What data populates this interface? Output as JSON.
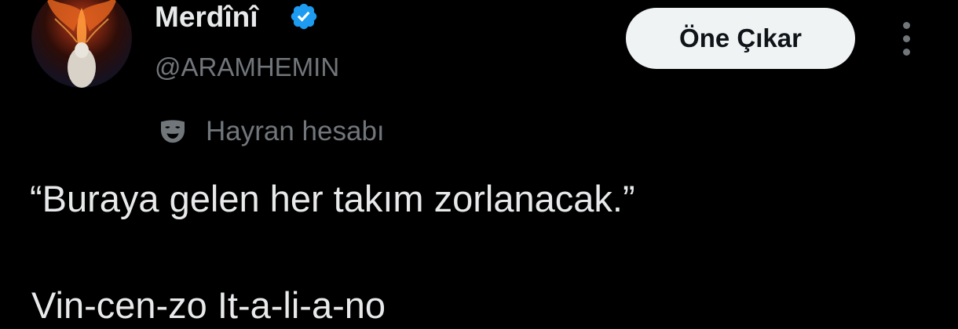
{
  "author": {
    "display_name": "Merdînî",
    "handle": "@ARAMHEMIN",
    "verified": true,
    "avatar_icon": "phoenix-avatar"
  },
  "actions": {
    "highlight_label": "Öne Çıkar",
    "more_icon": "more-vertical-icon"
  },
  "account_label": {
    "icon": "mask-icon",
    "text": "Hayran hesabı"
  },
  "tweet": {
    "line1": "“Buraya gelen her takım zorlanacak.”",
    "line2": "Vin-cen-zo It-a-li-a-no"
  },
  "colors": {
    "background": "#000000",
    "text_primary": "#e7e9ea",
    "text_secondary": "#71767b",
    "verified_blue": "#1d9bf0",
    "button_bg": "#eff3f4",
    "button_text": "#0f1419"
  }
}
